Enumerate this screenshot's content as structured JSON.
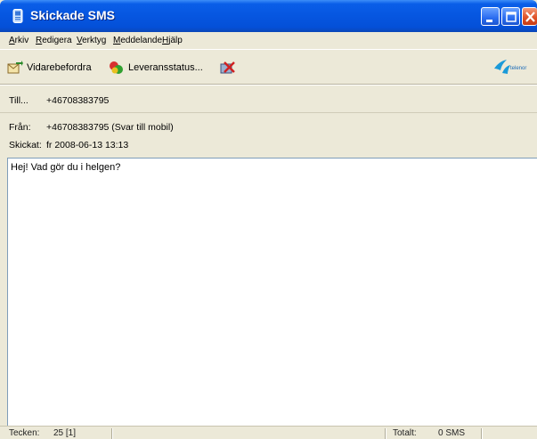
{
  "window": {
    "title": "Skickade SMS"
  },
  "menu": {
    "items": [
      {
        "label": "Arkiv"
      },
      {
        "label": "Redigera"
      },
      {
        "label": "Verktyg"
      },
      {
        "label": "Meddelande"
      },
      {
        "label": "Hjälp"
      }
    ]
  },
  "toolbar": {
    "forward_label": "Vidarebefordra",
    "delivery_status_label": "Leveransstatus...",
    "logo_text": "telenor"
  },
  "header": {
    "to_label": "Till...",
    "to_value": "+46708383795",
    "from_label": "Från:",
    "from_value": "+46708383795 (Svar till mobil)",
    "sent_label": "Skickat:",
    "sent_value": "fr 2008-06-13 13:13"
  },
  "message": {
    "body": "Hej! Vad gör du i helgen?"
  },
  "status": {
    "chars_label": "Tecken:",
    "chars_value": "25 [1]",
    "total_label": "Totalt:",
    "total_value": "0 SMS"
  },
  "colors": {
    "titlebar": "#0656e0",
    "close_button": "#e0542a",
    "window_bg": "#ece9d8",
    "brand_blue": "#1a9ad8"
  }
}
